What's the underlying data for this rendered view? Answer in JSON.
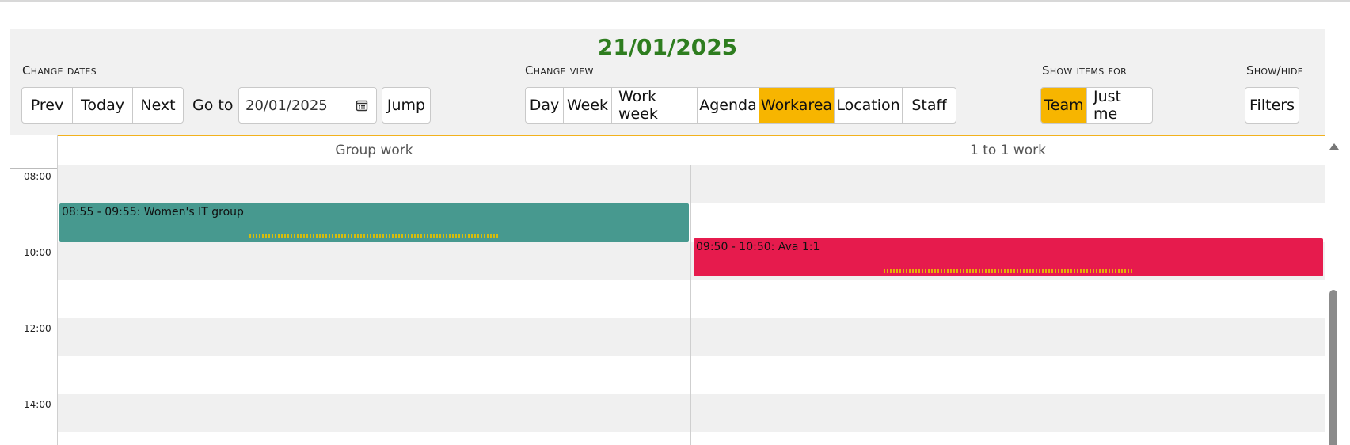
{
  "header": {
    "date": "21/01/2025"
  },
  "change_dates": {
    "label": "Change dates",
    "prev": "Prev",
    "today": "Today",
    "next": "Next",
    "goto_label": "Go to",
    "goto_value": "20/01/2025",
    "jump": "Jump"
  },
  "change_view": {
    "label": "Change view",
    "options": [
      "Day",
      "Week",
      "Work week",
      "Agenda",
      "Workarea",
      "Location",
      "Staff"
    ],
    "active": "Workarea"
  },
  "show_items": {
    "label": "Show items for",
    "options": [
      "Team",
      "Just me"
    ],
    "active": "Team"
  },
  "show_hide": {
    "label": "Show/hide",
    "filters": "Filters"
  },
  "columns": [
    "Group work",
    "1 to 1 work"
  ],
  "times": [
    "08:00",
    "10:00",
    "12:00",
    "14:00"
  ],
  "events": [
    {
      "column": "Group work",
      "label": "08:55 - 09:55: Women's IT group",
      "color": "#47998f"
    },
    {
      "column": "1 to 1 work",
      "label": "09:50 - 10:50: Ava 1:1",
      "color": "#e61b4d"
    }
  ],
  "colors": {
    "accent": "#f7b500",
    "date_title": "#2e7d1f"
  }
}
